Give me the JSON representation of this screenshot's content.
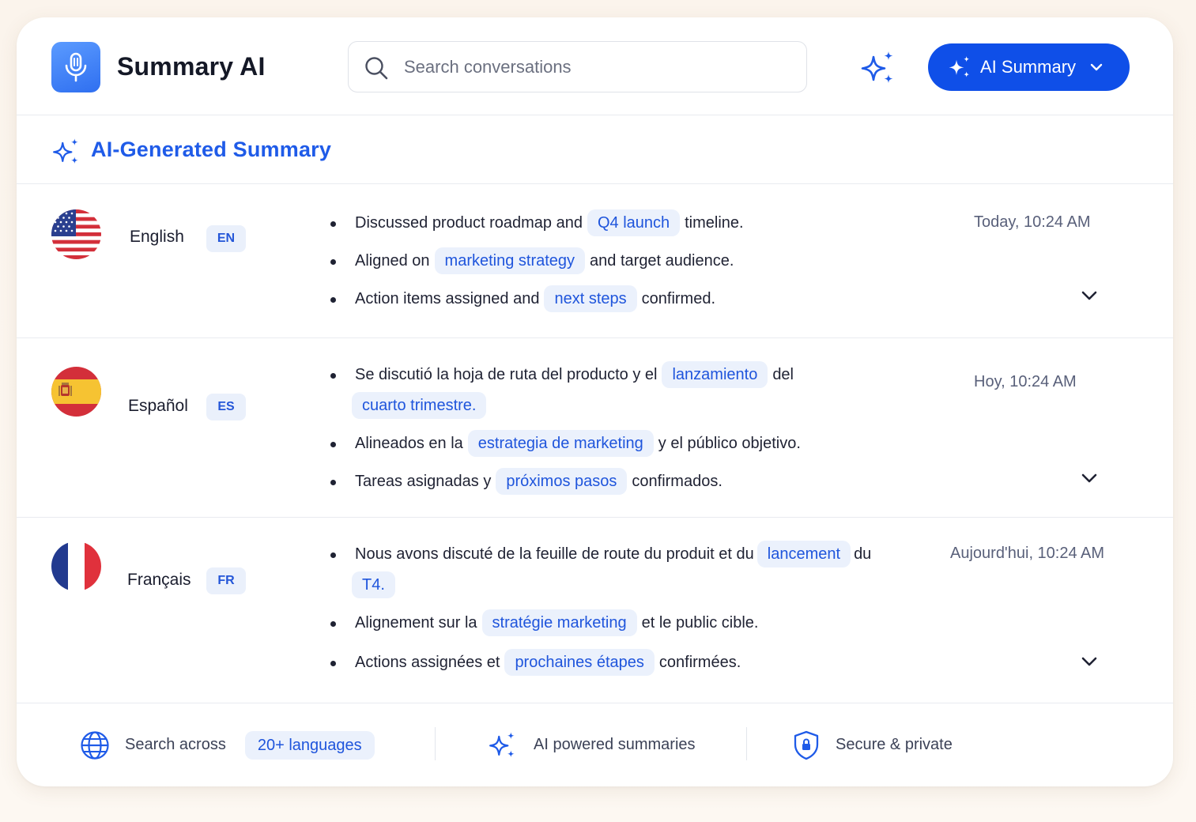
{
  "header": {
    "app_title": "Summary AI",
    "logo_icon": "microphone-icon",
    "search_placeholder": "Search conversations",
    "ai_button_label": "AI Summary"
  },
  "section": {
    "title": "AI-Generated Summary"
  },
  "languages": [
    {
      "name": "English",
      "code": "EN",
      "timestamp": "Today, 10:24 AM",
      "bullets": [
        {
          "before": "Discussed product roadmap and",
          "chip": "Q4 launch",
          "after": "timeline."
        },
        {
          "before": "Aligned on",
          "chip": "marketing strategy",
          "after": "and target audience."
        },
        {
          "before": "Action items assigned and",
          "chip": "next steps",
          "after": "confirmed."
        }
      ]
    },
    {
      "name": "Español",
      "code": "ES",
      "timestamp": "Hoy, 10:24 AM",
      "bullets": [
        {
          "before": "Se discutió la hoja de ruta del producto y el",
          "chip": "lanzamiento",
          "after": "del",
          "chip2": "cuarto trimestre."
        },
        {
          "before": "Alineados en la",
          "chip": "estrategia de marketing",
          "after": "y el público objetivo."
        },
        {
          "before": "Tareas asignadas y",
          "chip": "próximos pasos",
          "after": "confirmados."
        }
      ]
    },
    {
      "name": "Français",
      "code": "FR",
      "timestamp": "Aujourd'hui, 10:24 AM",
      "bullets": [
        {
          "before": "Nous avons discuté de la feuille de route du produit et du",
          "chip": "lancement",
          "after": "du",
          "chip2": "T4."
        },
        {
          "before": "Alignement sur la",
          "chip": "stratégie marketing",
          "after": "et le public cible."
        },
        {
          "before": "Actions assignées et",
          "chip": "prochaines étapes",
          "after": "confirmées."
        }
      ]
    }
  ],
  "footer": {
    "search_text": "Search across",
    "search_chip": "20+ languages",
    "ai_text": "AI powered summaries",
    "secure_text": "Secure & private"
  },
  "colors": {
    "accent": "#0f4fe8",
    "chip_bg": "#ebf1fc",
    "chip_text": "#1f55dc"
  }
}
